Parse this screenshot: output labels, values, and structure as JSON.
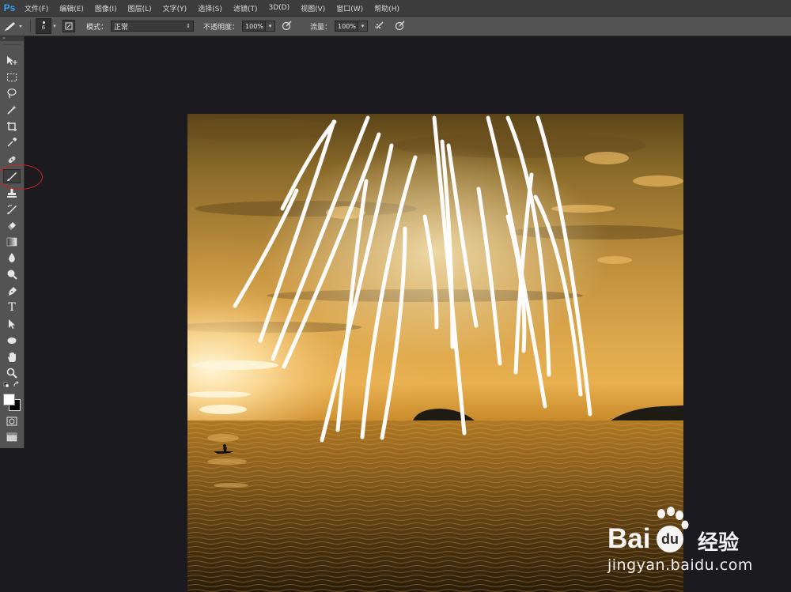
{
  "app": {
    "logo": "Ps"
  },
  "menu": [
    "文件(F)",
    "编辑(E)",
    "图像(I)",
    "图层(L)",
    "文字(Y)",
    "选择(S)",
    "滤镜(T)",
    "3D(D)",
    "视图(V)",
    "窗口(W)",
    "帮助(H)"
  ],
  "options": {
    "brush_size": "6",
    "mode_label": "模式：",
    "mode_value": "正常",
    "opacity_label": "不透明度：",
    "opacity_value": "100%",
    "flow_label": "流量：",
    "flow_value": "100%"
  },
  "toolbox": {
    "header": "»",
    "tools": [
      "move-tool",
      "marquee-tool",
      "lasso-tool",
      "magic-wand-tool",
      "crop-tool",
      "eyedropper-tool",
      "healing-brush-tool",
      "brush-tool",
      "clone-stamp-tool",
      "history-brush-tool",
      "eraser-tool",
      "gradient-tool",
      "blur-tool",
      "dodge-tool",
      "pen-tool",
      "type-tool",
      "path-selection-tool",
      "ellipse-tool",
      "hand-tool",
      "zoom-tool",
      "default-colors",
      "quick-mask",
      "screen-mode"
    ],
    "type_glyph": "T",
    "foreground_color": "#ffffff",
    "background_color": "#000000",
    "selected_tool": "brush-tool"
  },
  "watermark": {
    "brand": "Bai",
    "brand_cn": "经验",
    "url": "jingyan.baidu.com"
  },
  "colors": {
    "menubar": "#3c3c3c",
    "panel": "#535353",
    "workspace": "#1b1a1f",
    "highlight_circle": "#d11f1f",
    "brush_stroke": "#ffffff"
  }
}
